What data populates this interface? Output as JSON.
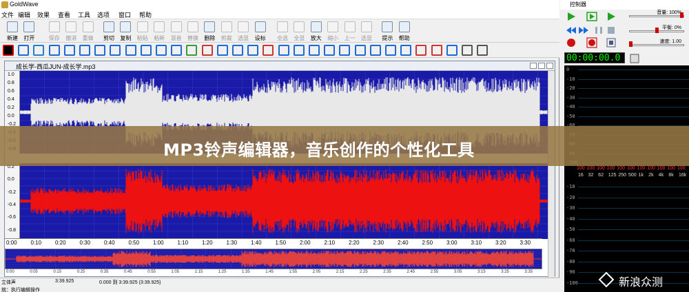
{
  "app": {
    "title": "GoldWave"
  },
  "menu": {
    "items": [
      "文件",
      "编辑",
      "效果",
      "查看",
      "工具",
      "选项",
      "窗口",
      "帮助"
    ]
  },
  "toolbar": {
    "buttons": [
      {
        "label": "新建",
        "dim": false
      },
      {
        "label": "打开",
        "dim": false
      },
      {
        "label": "保存",
        "dim": true
      },
      {
        "label": "撤消",
        "dim": true
      },
      {
        "label": "重做",
        "dim": true
      },
      {
        "label": "剪切",
        "dim": false
      },
      {
        "label": "复制",
        "dim": false
      },
      {
        "label": "粘贴",
        "dim": true
      },
      {
        "label": "粘新",
        "dim": true
      },
      {
        "label": "混音",
        "dim": true
      },
      {
        "label": "替换",
        "dim": true
      },
      {
        "label": "删除",
        "dim": false
      },
      {
        "label": "剪裁",
        "dim": true
      },
      {
        "label": "选显",
        "dim": true
      },
      {
        "label": "设标",
        "dim": false
      },
      {
        "label": "全选",
        "dim": true
      },
      {
        "label": "全显",
        "dim": true
      },
      {
        "label": "放大",
        "dim": false
      },
      {
        "label": "缩小",
        "dim": true
      },
      {
        "label": "上一",
        "dim": true
      },
      {
        "label": "选显",
        "dim": true
      },
      {
        "label": "提示",
        "dim": false
      },
      {
        "label": "帮助",
        "dim": false
      }
    ]
  },
  "document": {
    "title": "成长学-西瓜JUN-成长学.mp3",
    "scale_labels": [
      "1.0",
      "0.8",
      "0.6",
      "0.4",
      "0.2",
      "0.0",
      "-0.2",
      "-0.4",
      "-0.6",
      "-0.8"
    ],
    "scale_labels_bottom": [
      "0.2",
      "0.0",
      "-0.2",
      "-0.4",
      "-0.6",
      "-0.8"
    ],
    "timeline": [
      "0:00",
      "0:10",
      "0:20",
      "0:30",
      "0:40",
      "0:50",
      "1:00",
      "1:10",
      "1:20",
      "1:30",
      "1:40",
      "1:50",
      "2:00",
      "2:10",
      "2:20",
      "2:30",
      "2:40",
      "2:50",
      "3:00",
      "3:10",
      "3:20",
      "3:30"
    ],
    "overview_ruler": [
      "0:00",
      "0:05",
      "0:15",
      "0:25",
      "0:35",
      "0:45",
      "0:55",
      "1:05",
      "1:15",
      "1:25",
      "1:35",
      "1:45",
      "1:55",
      "2:05",
      "2:15",
      "2:25",
      "2:35",
      "2:45",
      "2:55",
      "3:05",
      "3:15",
      "3:25",
      "3:35"
    ]
  },
  "banner": {
    "text": "MP3铃声编辑器，音乐创作的个性化工具"
  },
  "status": {
    "channel": "立体声",
    "duration": "3:39.925",
    "selection": "0.000 到 3:39.925 (3:39.925)",
    "message": "就：执行编辑操作"
  },
  "control": {
    "title": "控制器",
    "volume_label": "音量: 100%",
    "balance_label": "平衡: 0%",
    "speed_label": "速度: 1.00",
    "timer": "00:00:00.0",
    "level_labels": [
      "0",
      "-10",
      "-20",
      "-30",
      "-40",
      "-50",
      "-60",
      "-70",
      "-80",
      "-90",
      "-100"
    ],
    "level_labels_bottom": [
      "-10",
      "-20",
      "-30",
      "-40",
      "-50",
      "-60",
      "-70",
      "-80",
      "-90",
      "-100"
    ],
    "freq_labels": [
      "16",
      "32",
      "62",
      "125",
      "250",
      "500",
      "1k",
      "2k",
      "4k",
      "8k",
      "16k"
    ],
    "red_labels": [
      "100",
      "100",
      "100",
      "100",
      "100",
      "100",
      "100",
      "100",
      "100",
      "100",
      "100"
    ],
    "colors": {
      "play": "#1fa51f",
      "record": "#d01010",
      "timer": "#00ff00"
    }
  },
  "watermark": {
    "text": "新浪众测"
  }
}
